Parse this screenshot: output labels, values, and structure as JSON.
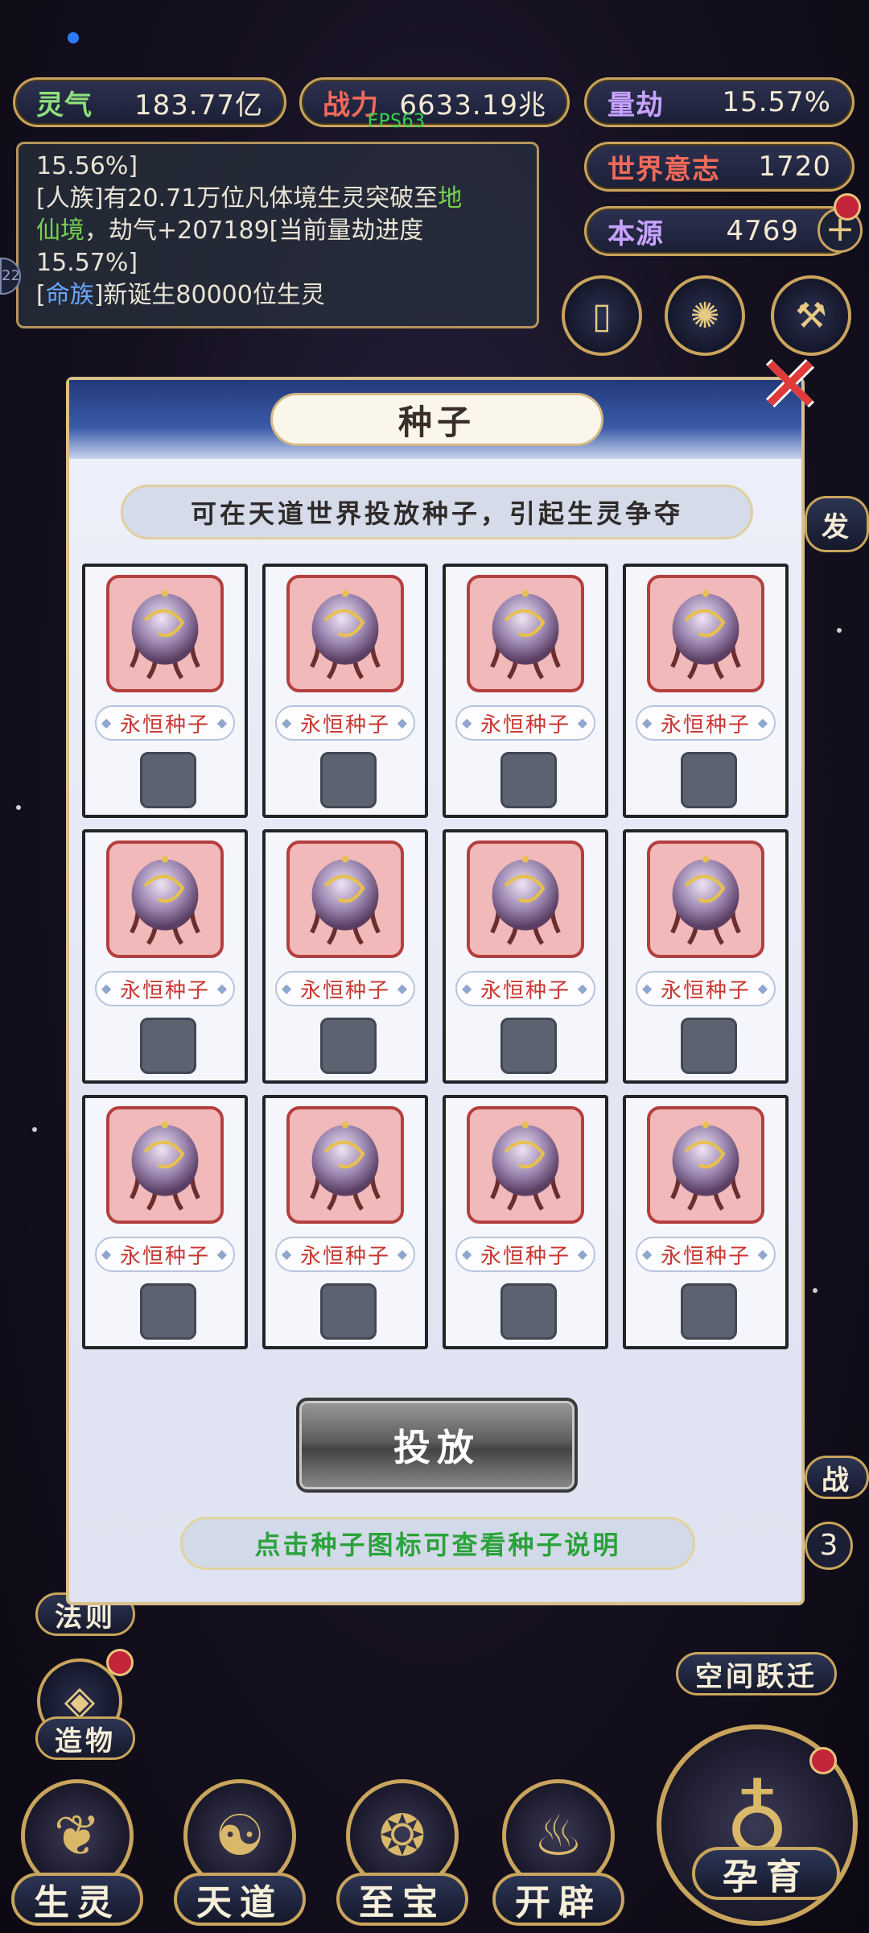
{
  "stats": {
    "lingqi": {
      "label": "灵气",
      "value": "183.77亿"
    },
    "zhanli": {
      "label": "战力",
      "value": "6633.19兆"
    },
    "liangjie": {
      "label": "量劫",
      "value": "15.57%"
    },
    "shijie": {
      "label": "世界意志",
      "value": "1720"
    },
    "benyuan": {
      "label": "本源",
      "value": "4769"
    }
  },
  "fps": "FPS63",
  "log": {
    "line1": "15.56%]",
    "line2_a": "[人族]有20.71万位凡体境生灵突破至",
    "line2_b": "地",
    "line3_a": "仙境",
    "line3_b": "，劫气+207189[当前量劫进度",
    "line4": "15.57%]",
    "line5_a": "[",
    "line5_b": "命族",
    "line5_c": "]新诞生80000位生灵"
  },
  "left_edge_text": "22",
  "side_right": {
    "fa": "发",
    "zhan": "战",
    "num": "3",
    "kongjian": "空间跃迁"
  },
  "side_left": {
    "faze": "法则",
    "zaowu": "造物"
  },
  "modal": {
    "title": "种子",
    "description": "可在天道世界投放种子，引起生灵争夺",
    "cards": [
      {
        "name": "永恒种子"
      },
      {
        "name": "永恒种子"
      },
      {
        "name": "永恒种子"
      },
      {
        "name": "永恒种子"
      },
      {
        "name": "永恒种子"
      },
      {
        "name": "永恒种子"
      },
      {
        "name": "永恒种子"
      },
      {
        "name": "永恒种子"
      },
      {
        "name": "永恒种子"
      },
      {
        "name": "永恒种子"
      },
      {
        "name": "永恒种子"
      },
      {
        "name": "永恒种子"
      }
    ],
    "action_button": "投放",
    "hint": "点击种子图标可查看种子说明",
    "close_icon": "close-x-icon"
  },
  "bottom_nav": [
    {
      "label": "生灵"
    },
    {
      "label": "天道"
    },
    {
      "label": "至宝"
    },
    {
      "label": "开辟"
    },
    {
      "label": "孕育"
    }
  ],
  "colors": {
    "gold": "#c9a45c",
    "name_red": "#c8372f",
    "hint_green": "#2aa33a",
    "log_green": "#75d04f",
    "log_blue": "#6aa7ff"
  }
}
